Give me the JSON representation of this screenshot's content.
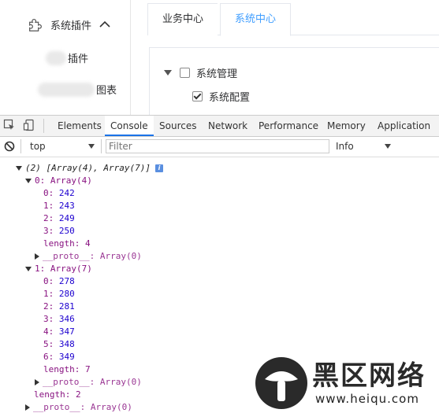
{
  "sidebar": {
    "section_label": "系统插件",
    "items": [
      {
        "label": "插件"
      },
      {
        "label": "图表"
      }
    ]
  },
  "tabs": [
    {
      "label": "业务中心",
      "active": false
    },
    {
      "label": "系统中心",
      "active": true
    }
  ],
  "tree": [
    {
      "label": "系统管理",
      "checked": false
    },
    {
      "label": "系统配置",
      "checked": true
    }
  ],
  "devtools": {
    "tabs": [
      "Elements",
      "Console",
      "Sources",
      "Network",
      "Performance",
      "Memory",
      "Application"
    ],
    "active_tab": "Console",
    "context": "top",
    "filter_placeholder": "Filter",
    "levels": "Info"
  },
  "console": {
    "summary": "(2) [Array(4), Array(7)]",
    "arrays": [
      {
        "label": "0: Array(4)",
        "values": [
          242,
          243,
          249,
          250
        ],
        "length_label": "length: 4",
        "proto": "__proto__: Array(0)"
      },
      {
        "label": "1: Array(7)",
        "values": [
          278,
          280,
          281,
          346,
          347,
          348,
          349
        ],
        "length_label": "length: 7",
        "proto": "__proto__: Array(0)"
      }
    ],
    "outer_length": "length: 2",
    "outer_proto": "__proto__: Array(0)"
  },
  "watermark": {
    "text": "黑区网络",
    "url": "www.heiqu.com"
  },
  "colors": {
    "accent": "#409eff",
    "devtools_active": "#1a73e8",
    "key": "#881280",
    "number": "#1c00cf"
  }
}
